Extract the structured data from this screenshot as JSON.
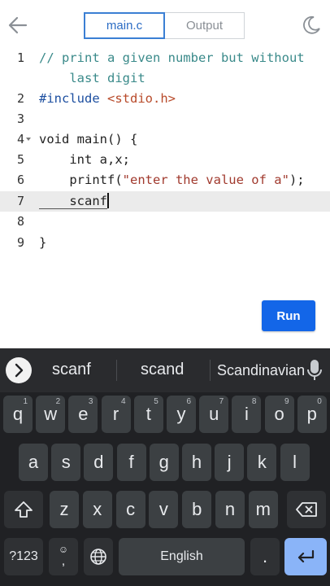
{
  "header": {
    "tabs": [
      {
        "label": "main.c",
        "active": true
      },
      {
        "label": "Output",
        "active": false
      }
    ],
    "icons": {
      "back": "arrow-left-icon",
      "theme": "moon-icon"
    }
  },
  "editor": {
    "lines": [
      {
        "num": "1",
        "text": "// print a given number but without"
      },
      {
        "num": "",
        "text": "    last digit"
      },
      {
        "num": "2",
        "text": "#include <stdio.h>"
      },
      {
        "num": "3",
        "text": ""
      },
      {
        "num": "4",
        "text": "void main() {"
      },
      {
        "num": "5",
        "text": "    int a,x;"
      },
      {
        "num": "6",
        "text": "    printf(\"enter the value of a\");"
      },
      {
        "num": "7",
        "text": "    scanf"
      },
      {
        "num": "8",
        "text": ""
      },
      {
        "num": "9",
        "text": "}"
      }
    ],
    "run_label": "Run"
  },
  "keyboard": {
    "suggestions": [
      "scanf",
      "scand",
      "Scandinavian"
    ],
    "row1": [
      {
        "k": "q",
        "h": "1"
      },
      {
        "k": "w",
        "h": "2"
      },
      {
        "k": "e",
        "h": "3"
      },
      {
        "k": "r",
        "h": "4"
      },
      {
        "k": "t",
        "h": "5"
      },
      {
        "k": "y",
        "h": "6"
      },
      {
        "k": "u",
        "h": "7"
      },
      {
        "k": "i",
        "h": "8"
      },
      {
        "k": "o",
        "h": "9"
      },
      {
        "k": "p",
        "h": "0"
      }
    ],
    "row2": [
      "a",
      "s",
      "d",
      "f",
      "g",
      "h",
      "j",
      "k",
      "l"
    ],
    "row3": [
      "z",
      "x",
      "c",
      "v",
      "b",
      "n",
      "m"
    ],
    "symbols_label": "?123",
    "emoji_top": "☺",
    "comma": ",",
    "space_label": "English",
    "period": ".",
    "colors": {
      "keyboard_bg": "#202124",
      "key_bg": "#3c4043",
      "enter_bg": "#8ab4f8",
      "run_bg": "#1366e8"
    }
  }
}
